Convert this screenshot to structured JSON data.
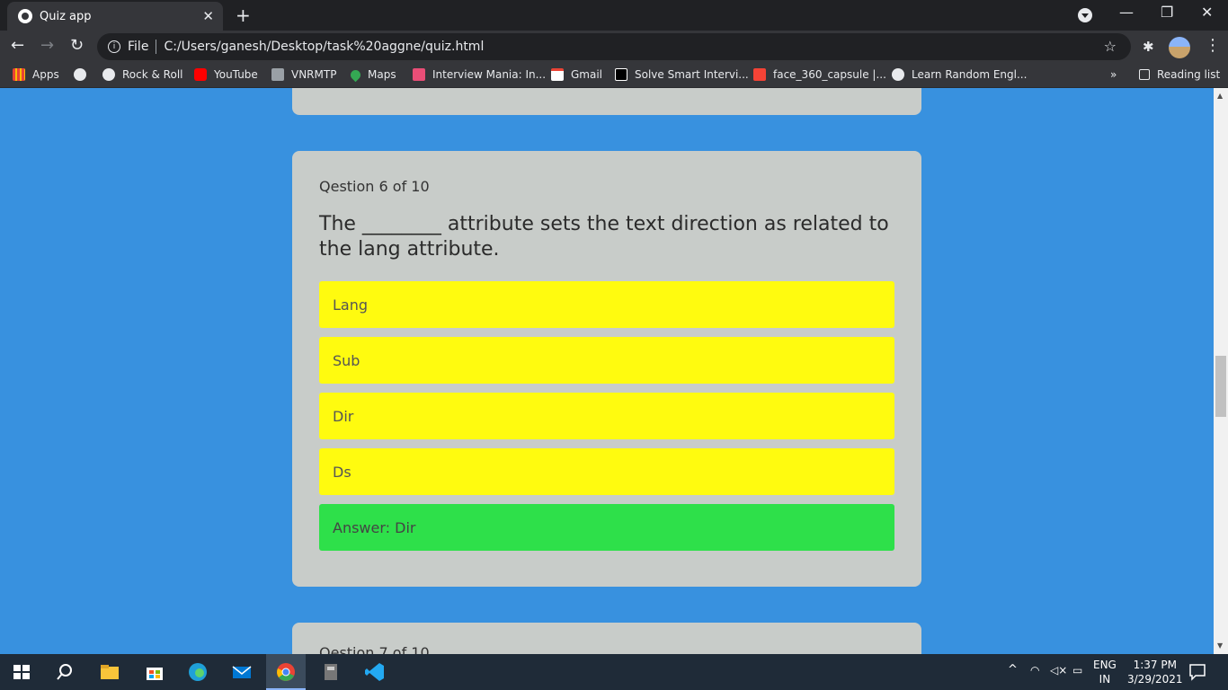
{
  "browser": {
    "tab_title": "Quiz app",
    "tab_close": "✕",
    "new_tab": "+",
    "url_prefix": "File",
    "url": "C:/Users/ganesh/Desktop/task%20aggne/quiz.html",
    "bookmarks": [
      "Apps",
      "Rock & Roll",
      "YouTube",
      "VNRMTP",
      "Maps",
      "Interview Mania: In...",
      "Gmail",
      "Solve Smart Intervi...",
      "face_360_capsule |...",
      "Learn Random Engl..."
    ],
    "more": "»",
    "reading_list": "Reading list"
  },
  "quiz": {
    "question_counter": "Qestion 6 of 10",
    "question_text": "The ________ attribute sets the text direction as related to the lang attribute.",
    "options": [
      "Lang",
      "Sub",
      "Dir",
      "Ds"
    ],
    "answer": "Answer: Dir",
    "next_counter_partial": "Qestion 7 of 10"
  },
  "taskbar": {
    "lang_top": "ENG",
    "lang_bottom": "IN",
    "time": "1:37 PM",
    "date": "3/29/2021"
  },
  "colors": {
    "page_bg": "#3891df",
    "card_bg": "#c8ccc9",
    "option_bg": "#fffb0f",
    "answer_bg": "#2ee04a"
  }
}
